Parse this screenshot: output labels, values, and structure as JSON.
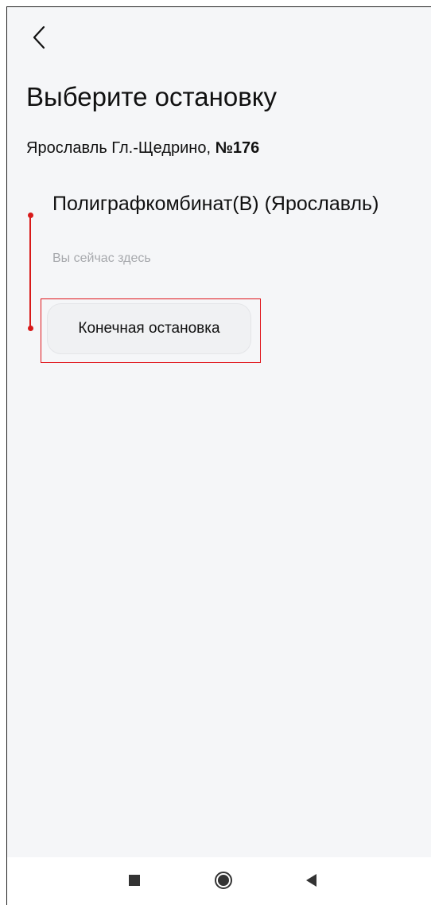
{
  "header": {
    "back_icon": "chevron-left-icon",
    "title": "Выберите остановку"
  },
  "route": {
    "name": "Ярославль Гл.-Щедрино, ",
    "number": "№176"
  },
  "current_stop": {
    "name": "Полиграфкомбинат(В) (Ярославль)",
    "hint": "Вы сейчас здесь"
  },
  "final_stop": {
    "label": "Конечная остановка"
  },
  "navigation_bar": {
    "recents_icon": "square-icon",
    "home_icon": "circle-icon",
    "back_icon": "triangle-left-icon"
  },
  "colors": {
    "accent": "#d81a1a",
    "background": "#f5f6f8",
    "highlight": "#e0151b"
  }
}
